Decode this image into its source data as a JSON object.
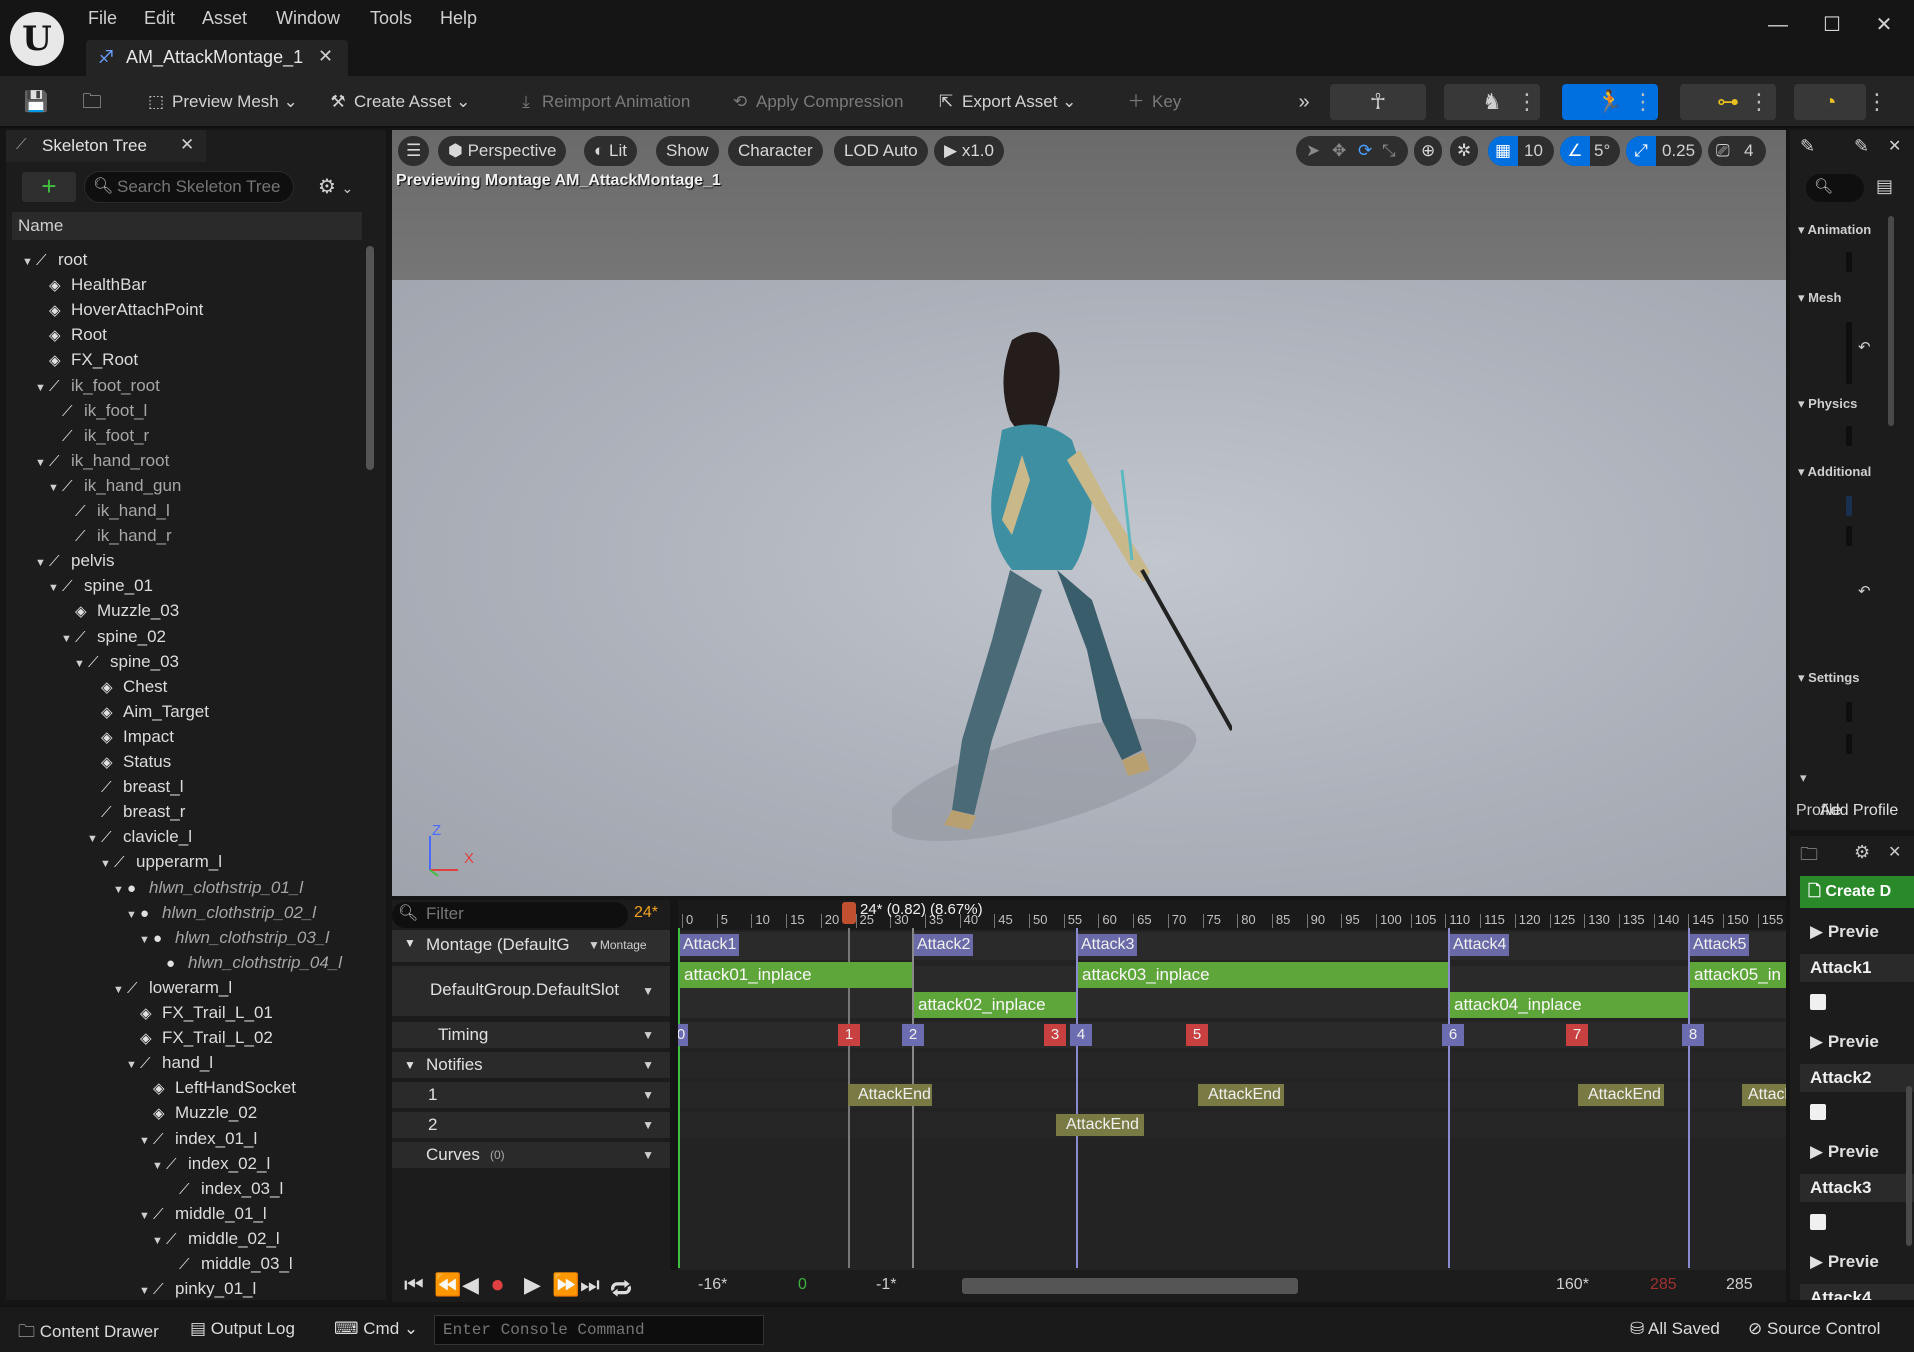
{
  "app": {
    "menu": [
      "File",
      "Edit",
      "Asset",
      "Window",
      "Tools",
      "Help"
    ],
    "tab_title": "AM_AttackMontage_1"
  },
  "toolbar": {
    "preview_mesh": "Preview Mesh",
    "create_asset": "Create Asset",
    "reimport": "Reimport Animation",
    "apply_compression": "Apply Compression",
    "export_asset": "Export Asset",
    "key": "Key"
  },
  "skeleton": {
    "tab": "Skeleton Tree",
    "search_placeholder": "Search Skeleton Tree",
    "column": "Name",
    "bones": [
      "root",
      "HealthBar",
      "HoverAttachPoint",
      "Root",
      "FX_Root",
      "ik_foot_root",
      "ik_foot_l",
      "ik_foot_r",
      "ik_hand_root",
      "ik_hand_gun",
      "ik_hand_l",
      "ik_hand_r",
      "pelvis",
      "spine_01",
      "Muzzle_03",
      "spine_02",
      "spine_03",
      "Chest",
      "Aim_Target",
      "Impact",
      "Status",
      "breast_l",
      "breast_r",
      "clavicle_l",
      "upperarm_l",
      "hlwn_clothstrip_01_l",
      "hlwn_clothstrip_02_l",
      "hlwn_clothstrip_03_l",
      "hlwn_clothstrip_04_l",
      "lowerarm_l",
      "FX_Trail_L_01",
      "FX_Trail_L_02",
      "hand_l",
      "LeftHandSocket",
      "Muzzle_02",
      "index_01_l",
      "index_02_l",
      "index_03_l",
      "middle_01_l",
      "middle_02_l",
      "middle_03_l",
      "pinky_01_l"
    ]
  },
  "viewport": {
    "perspective": "Perspective",
    "lit": "Lit",
    "show": "Show",
    "character": "Character",
    "lod": "LOD Auto",
    "speed": "x1.0",
    "grid_snap": "10",
    "rot_snap": "5°",
    "scale_snap": "0.25",
    "cam_speed": "4",
    "caption": "Previewing Montage AM_AttackMontage_1",
    "axis_z": "Z",
    "axis_x": "X"
  },
  "details": {
    "sections": [
      "Animation",
      "Mesh",
      "Physics",
      "Additional",
      "Settings"
    ],
    "profile": "Profile",
    "add_profile": "Add Profile"
  },
  "preview": {
    "create": "Create D",
    "preview_label": "Previe",
    "attacks": [
      "Attack1",
      "Attack2",
      "Attack3",
      "Attack4"
    ]
  },
  "montage": {
    "filter_placeholder": "Filter",
    "fps": "24*",
    "montage_row": "Montage (DefaultG",
    "montage_tag": "Montage",
    "slot_row": "DefaultGroup.DefaultSlot",
    "timing": "Timing",
    "notifies": "Notifies",
    "track1": "1",
    "track2": "2",
    "curves": "Curves",
    "curves_count": "(0)"
  },
  "timeline": {
    "playhead_label": "24* (0.82) (8.67%)",
    "ticks": [
      "0",
      "5",
      "10",
      "15",
      "20",
      "25",
      "30",
      "35",
      "40",
      "45",
      "50",
      "55",
      "60",
      "65",
      "70",
      "75",
      "80",
      "85",
      "90",
      "95",
      "100",
      "105",
      "110",
      "115",
      "120",
      "125",
      "130",
      "135",
      "140",
      "145",
      "150",
      "155"
    ],
    "sections": [
      "Attack1",
      "Attack2",
      "Attack3",
      "Attack4",
      "Attack5"
    ],
    "segments_top": [
      "attack01_inplace",
      "attack03_inplace",
      "attack05_in"
    ],
    "segments_bottom": [
      "attack02_inplace",
      "attack04_inplace"
    ],
    "timing_markers": [
      "0",
      "1",
      "2",
      "3",
      "4",
      "5",
      "6",
      "7",
      "8"
    ],
    "notify_label": "AttackEnd",
    "notify_short": "Attack"
  },
  "transport": {
    "start": "-16*",
    "zero": "0",
    "neg1": "-1*",
    "v160": "160*",
    "v285red": "285",
    "v285": "285"
  },
  "statusbar": {
    "content_drawer": "Content Drawer",
    "output_log": "Output Log",
    "cmd": "Cmd",
    "console_placeholder": "Enter Console Command",
    "all_saved": "All Saved",
    "source_control": "Source Control"
  }
}
